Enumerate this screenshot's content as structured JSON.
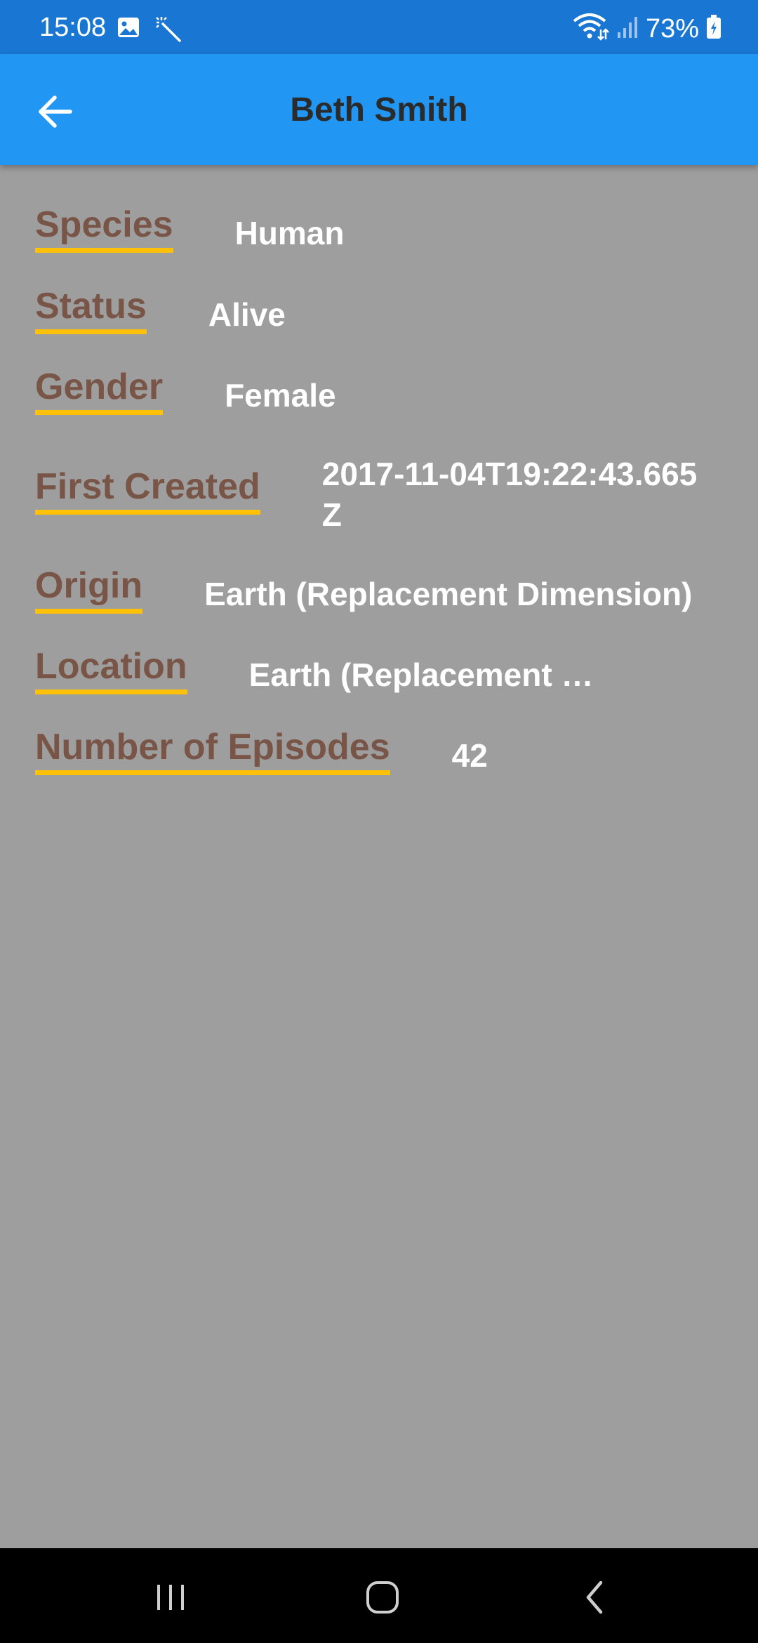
{
  "status_bar": {
    "time": "15:08",
    "left_icons": [
      "image-icon",
      "magic-wand-icon"
    ],
    "right_icons": [
      "wifi-icon",
      "signal-icon",
      "battery-charging-icon"
    ],
    "battery": "73%"
  },
  "app_bar": {
    "title": "Beth Smith",
    "back_icon": "arrow-left-icon"
  },
  "details": {
    "species": {
      "label": "Species",
      "value": "Human"
    },
    "status": {
      "label": "Status",
      "value": "Alive"
    },
    "gender": {
      "label": "Gender",
      "value": "Female"
    },
    "created": {
      "label": "First Created",
      "value": "2017-11-04T19:22:43.665Z"
    },
    "origin": {
      "label": "Origin",
      "value": "Earth (Replacement Dimension)"
    },
    "location": {
      "label": "Location",
      "value": "Earth (Replacement Dimension)"
    },
    "episodes": {
      "label": "Number of Episodes",
      "value": "42"
    }
  },
  "nav_bar": {
    "icons": [
      "recent-apps-icon",
      "home-icon",
      "back-icon"
    ]
  },
  "colors": {
    "status_bar": "#1976d2",
    "app_bar": "#2196f3",
    "background": "#9e9e9e",
    "label": "#795548",
    "underline": "#ffc107",
    "value": "#ffffff"
  }
}
